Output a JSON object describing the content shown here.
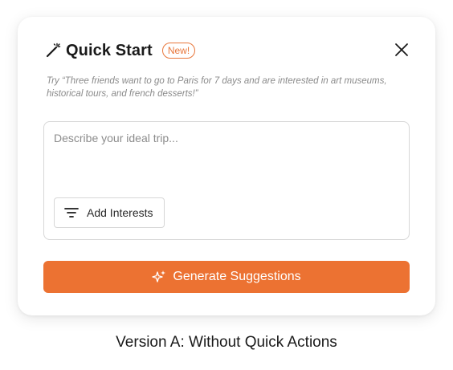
{
  "dialog": {
    "title": "Quick Start",
    "badge": "New!",
    "hint": "Try “Three friends want to go to Paris for 7 days and are interested in art museums, historical tours, and french desserts!”",
    "input": {
      "placeholder": "Describe your ideal trip...",
      "value": ""
    },
    "interests_button": {
      "label": "Add Interests",
      "icon": "filter-icon"
    },
    "generate_button": {
      "label": "Generate Suggestions",
      "icon": "sparkle-icon"
    },
    "close_icon": "close-icon",
    "title_icon": "magic-wand-icon"
  },
  "caption": "Version A: Without Quick Actions",
  "colors": {
    "accent": "#ec7232",
    "badge": "#e8763a",
    "text": "#1a1a1a",
    "muted": "#8a8a8a",
    "border": "#d7d7d7"
  }
}
